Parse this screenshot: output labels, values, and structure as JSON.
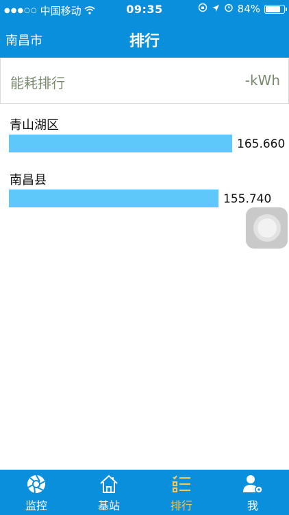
{
  "status": {
    "carrier": "中国移动",
    "time": "09:35",
    "battery": "84%",
    "battery_level": 0.84
  },
  "navbar": {
    "city": "南昌市",
    "title": "排行"
  },
  "metric": {
    "label": "能耗排行",
    "unit": "-kWh"
  },
  "ranking": [
    {
      "name": "青山湖区",
      "value": "165.660",
      "value_num": 165.66
    },
    {
      "name": "南昌县",
      "value": "155.740",
      "value_num": 155.74
    }
  ],
  "tabbar": {
    "tabs": [
      {
        "label": "监控",
        "icon": "aperture-icon"
      },
      {
        "label": "基站",
        "icon": "home-icon"
      },
      {
        "label": "排行",
        "icon": "list-icon",
        "active": true
      },
      {
        "label": "我",
        "icon": "user-settings-icon"
      }
    ]
  },
  "colors": {
    "primary": "#0a8fdc",
    "bar": "#5ec8fb",
    "active_tab": "#f0c95a",
    "metric_text": "#7a8a6e"
  }
}
